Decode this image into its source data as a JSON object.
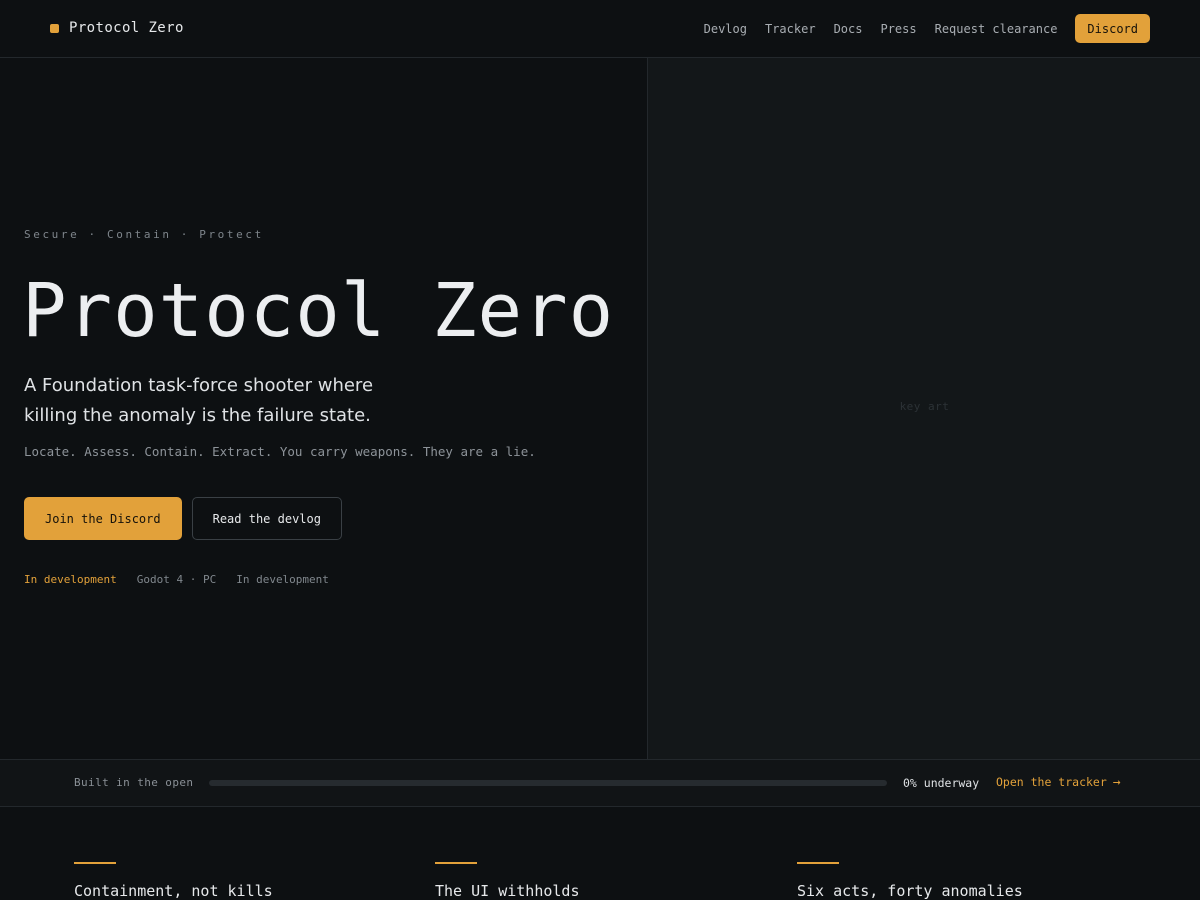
{
  "brand": {
    "name": "Protocol Zero",
    "accent": "#e2a13a"
  },
  "nav": {
    "links": [
      "Devlog",
      "Tracker",
      "Docs",
      "Press",
      "Request clearance"
    ],
    "cta": "Discord"
  },
  "hero": {
    "eyebrow": "Secure · Contain · Protect",
    "title": "Protocol Zero",
    "tagline": "A Foundation task-force shooter where killing the anomaly is the failure state.",
    "subline": "Locate. Assess. Contain. Extract. You carry weapons. They are a lie.",
    "primary_cta": "Join the Discord",
    "secondary_cta": "Read the devlog",
    "meta": {
      "status": "In development",
      "engine": "Godot 4 · PC",
      "stage": "In development"
    },
    "keyart_label": "key art"
  },
  "progress": {
    "label": "Built in the open",
    "percent": 0,
    "percent_text": "0% underway",
    "link": "Open the tracker",
    "link_icon": "arrow-right-icon"
  },
  "features": [
    {
      "title": "Containment, not kills"
    },
    {
      "title": "The UI withholds"
    },
    {
      "title": "Six acts, forty anomalies"
    }
  ]
}
